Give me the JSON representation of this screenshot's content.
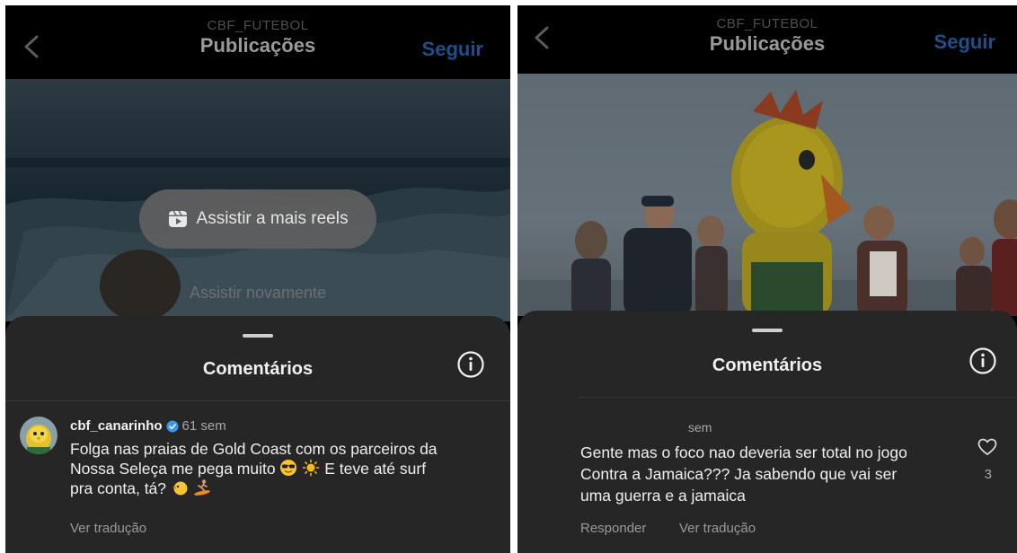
{
  "left": {
    "header": {
      "account": "CBF_FUTEBOL",
      "title": "Publicações",
      "follow_label": "Seguir"
    },
    "overlay": {
      "reels_label": "Assistir a mais reels",
      "replay_label": "Assistir novamente"
    },
    "comments": {
      "title": "Comentários",
      "items": [
        {
          "username": "cbf_canarinho",
          "time": "61 sem",
          "text_line1": "Folga nas praias de Gold Coast com os parceiros da",
          "text_line2": "Nossa Seleça me pega muito",
          "text_line3": "E teve até surf",
          "text_line4": "pra conta, tá?",
          "translate_label": "Ver tradução"
        }
      ]
    }
  },
  "right": {
    "header": {
      "account": "CBF_FUTEBOL",
      "title": "Publicações",
      "follow_label": "Seguir"
    },
    "comments": {
      "title": "Comentários",
      "items": [
        {
          "time": "sem",
          "text_line1": "Gente mas o foco nao deveria ser total no jogo",
          "text_line2": "Contra a Jamaica??? Ja sabendo que vai ser",
          "text_line3": "uma guerra e a jamaica",
          "likes": "3",
          "reply_label": "Responder",
          "translate_label": "Ver tradução"
        }
      ]
    }
  },
  "icons": {
    "back": "chevron-left-icon",
    "reels": "reels-icon",
    "info": "info-icon",
    "verified": "verified-badge-icon",
    "like": "heart-outline-icon"
  },
  "colors": {
    "background": "#000000",
    "sheet": "#262626",
    "follow": "#1f4f8a",
    "verified": "#3797f0",
    "text": "#efefef",
    "muted": "#a8a8a8"
  }
}
